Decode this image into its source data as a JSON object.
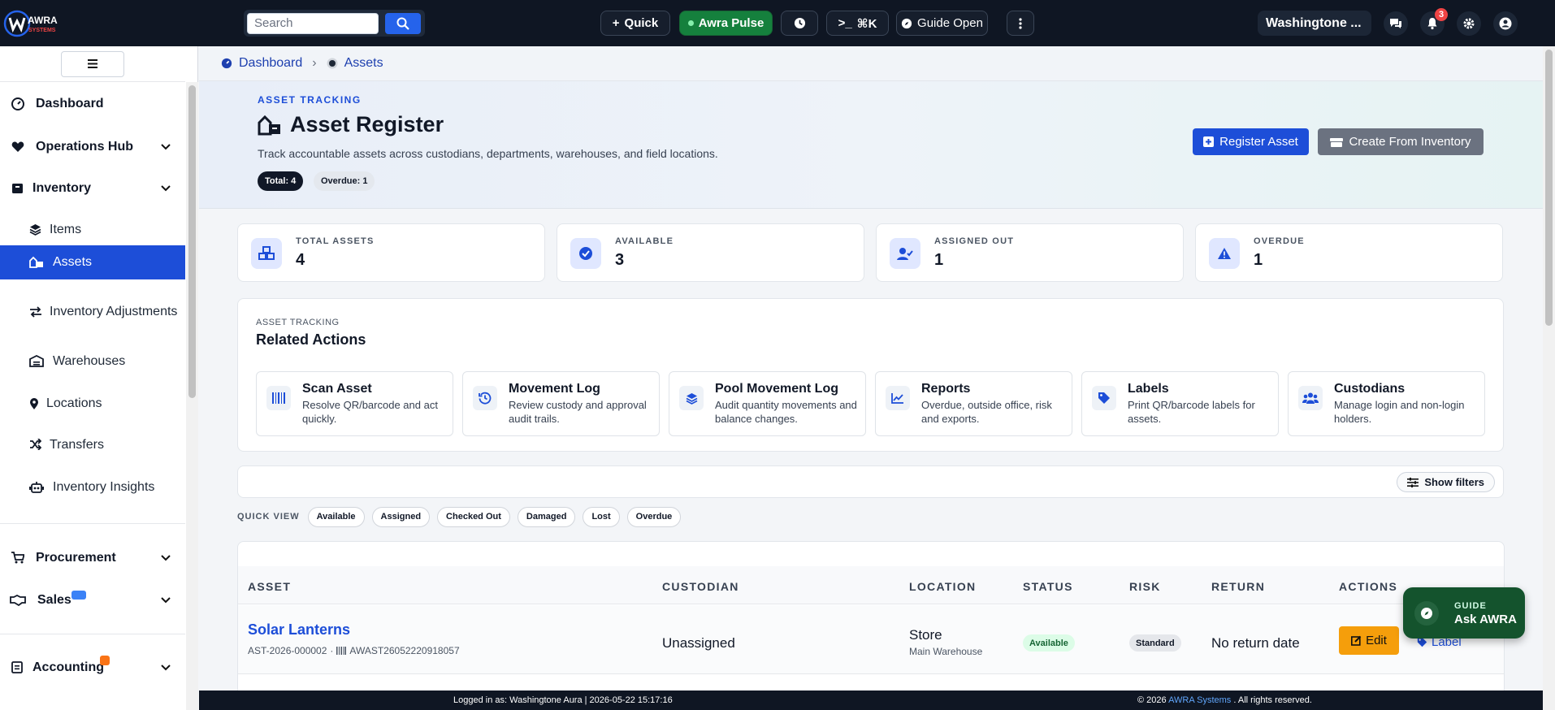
{
  "app": {
    "brand": "AWRA",
    "brand_sub": "SYSTEMS"
  },
  "topbar": {
    "search_placeholder": "Search",
    "quick_label": "Quick",
    "pulse_label": "Awra Pulse",
    "command_label": "⌘K",
    "guide_label": "Guide Open",
    "user_name": "Washingtone ...",
    "notification_count": "3"
  },
  "sidebar": {
    "items": [
      {
        "label": "Dashboard"
      },
      {
        "label": "Operations Hub"
      },
      {
        "label": "Inventory"
      },
      {
        "label": "Items"
      },
      {
        "label": "Assets"
      },
      {
        "label": "Inventory Adjustments"
      },
      {
        "label": "Warehouses"
      },
      {
        "label": "Locations"
      },
      {
        "label": "Transfers"
      },
      {
        "label": "Inventory Insights"
      },
      {
        "label": "Procurement"
      },
      {
        "label": "Sales"
      },
      {
        "label": "Accounting"
      }
    ]
  },
  "breadcrumb": {
    "home": "Dashboard",
    "current": "Assets"
  },
  "hero": {
    "kicker": "ASSET TRACKING",
    "title": "Asset Register",
    "description": "Track accountable assets across custodians, departments, warehouses, and field locations.",
    "total_pill": "Total: 4",
    "overdue_pill": "Overdue: 1",
    "register_btn": "Register Asset",
    "create_btn": "Create From Inventory"
  },
  "stats": [
    {
      "label": "TOTAL ASSETS",
      "value": "4"
    },
    {
      "label": "AVAILABLE",
      "value": "3"
    },
    {
      "label": "ASSIGNED OUT",
      "value": "1"
    },
    {
      "label": "OVERDUE",
      "value": "1"
    }
  ],
  "related": {
    "kicker": "ASSET TRACKING",
    "title": "Related Actions",
    "actions": [
      {
        "title": "Scan Asset",
        "desc": "Resolve QR/barcode and act quickly."
      },
      {
        "title": "Movement Log",
        "desc": "Review custody and approval audit trails."
      },
      {
        "title": "Pool Movement Log",
        "desc": "Audit quantity movements and balance changes."
      },
      {
        "title": "Reports",
        "desc": "Overdue, outside office, risk and exports."
      },
      {
        "title": "Labels",
        "desc": "Print QR/barcode labels for assets."
      },
      {
        "title": "Custodians",
        "desc": "Manage login and non-login holders."
      }
    ]
  },
  "filters": {
    "show_label": "Show filters"
  },
  "quick_view": {
    "label": "QUICK VIEW",
    "chips": [
      "Available",
      "Assigned",
      "Checked Out",
      "Damaged",
      "Lost",
      "Overdue"
    ]
  },
  "table": {
    "headers": [
      "ASSET",
      "CUSTODIAN",
      "LOCATION",
      "STATUS",
      "RISK",
      "RETURN",
      "ACTIONS"
    ],
    "rows": [
      {
        "asset": "Solar Lanterns",
        "code": "AST-2026-000002",
        "barcode": "AWAST26052220918057",
        "custodian": "Unassigned",
        "location": "Store",
        "location_sub": "Main Warehouse",
        "status": "Available",
        "risk": "Standard",
        "return": "No return date",
        "edit": "Edit",
        "label": "Label"
      }
    ]
  },
  "guide_fab": {
    "kicker": "GUIDE",
    "label": "Ask AWRA"
  },
  "footer": {
    "left": "Logged in as: Washingtone Aura | 2026-05-22 15:17:16",
    "right_pre": "© 2026 ",
    "right_brand": "AWRA Systems",
    "right_post": " . All rights reserved."
  },
  "colors": {
    "accent": "#1d4ed8",
    "topbar": "#0f1623",
    "warning": "#f59e0b",
    "success": "#15803d"
  }
}
